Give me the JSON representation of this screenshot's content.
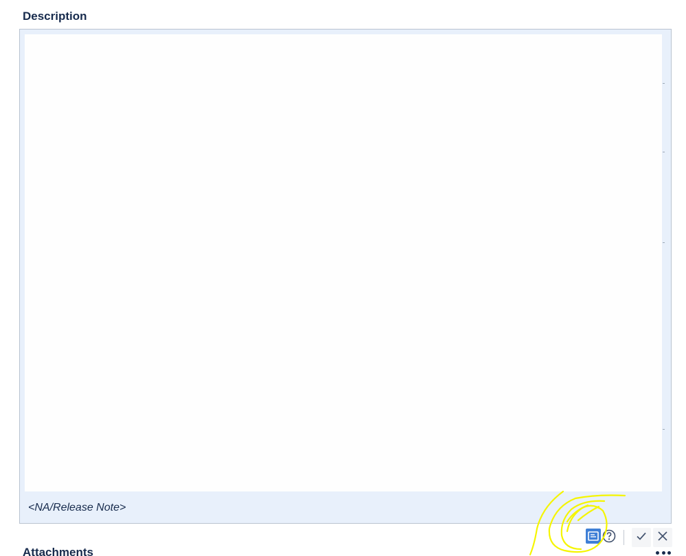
{
  "description": {
    "heading": "Description",
    "placeholder": "<NA/Release Note>"
  },
  "toolbar": {
    "preview_icon": "preview-panel-icon",
    "help_icon": "help-circle-icon",
    "save_icon": "checkmark-icon",
    "cancel_icon": "close-icon",
    "preview_color": "#3f7fd6"
  },
  "attachments": {
    "heading": "Attachments",
    "more_icon": "more-dots-icon"
  },
  "annotation": {
    "color": "#f5f500",
    "shape": "hand-drawn-scribble"
  }
}
